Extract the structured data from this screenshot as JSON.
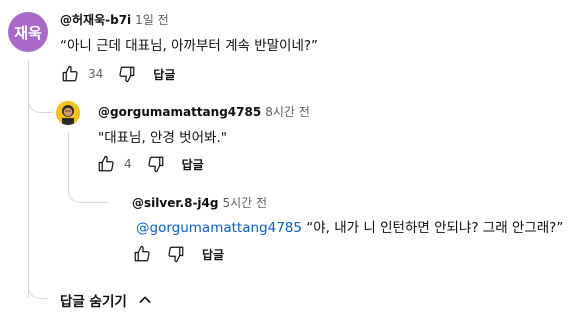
{
  "comment": {
    "avatar_text": "재욱",
    "handle": "@허재욱-b7i",
    "time": "1일 전",
    "text": "“아니 근데 대표님, 아까부터 계속 반말이네?”",
    "likes": "34",
    "reply_label": "답글"
  },
  "replies": [
    {
      "handle": "@gorgumamattang4785",
      "time": "8시간 전",
      "text": "\"대표님, 안경 벗어봐.\"",
      "likes": "4",
      "reply_label": "답글"
    },
    {
      "handle": "@silver.8-j4g",
      "time": "5시간 전",
      "mention": "@gorgumamattang4785",
      "text": " “야, 내가 니 인턴하면 안되냐? 그래 안그래?”",
      "likes": "",
      "reply_label": "답글"
    }
  ],
  "hide_replies_label": "답글 숨기기",
  "colors": {
    "avatar_bg": "#a869c9",
    "mention": "#065fd4",
    "thread_line": "#d9d9d9"
  }
}
